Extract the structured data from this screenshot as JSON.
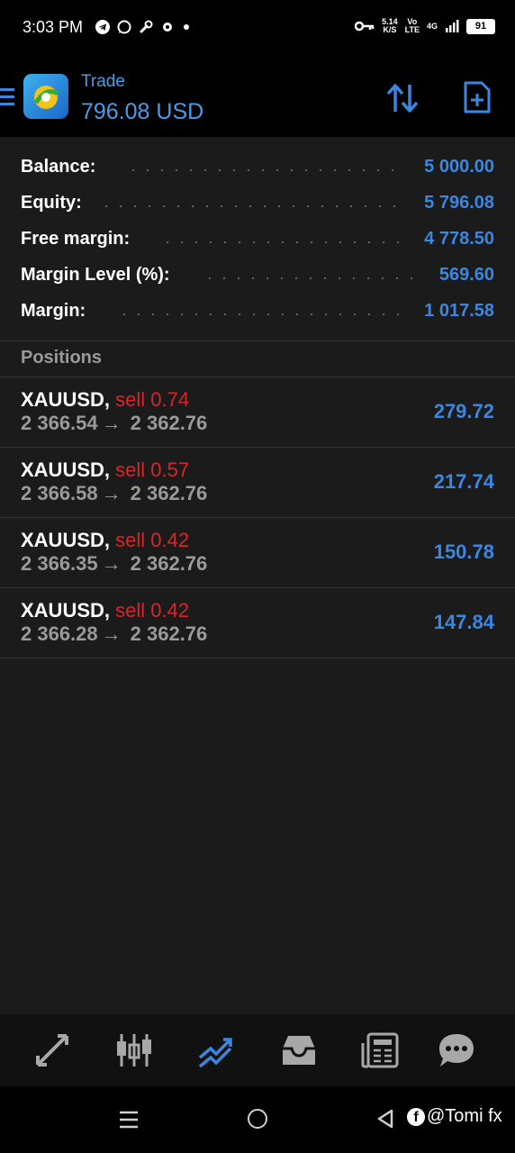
{
  "status_bar": {
    "time": "3:03 PM",
    "net_speed_value": "5.14",
    "net_speed_unit": "K/S",
    "volte_top": "Vo",
    "volte_bottom": "LTE",
    "network": "4G",
    "battery": "91"
  },
  "header": {
    "title": "Trade",
    "balance": "796.08 USD"
  },
  "summary": [
    {
      "label": "Balance:",
      "value": "5 000.00"
    },
    {
      "label": "Equity:",
      "value": "5 796.08"
    },
    {
      "label": "Free margin:",
      "value": "4 778.50"
    },
    {
      "label": "Margin Level (%):",
      "value": "569.60"
    },
    {
      "label": "Margin:",
      "value": "1 017.58"
    }
  ],
  "positions_header": "Positions",
  "positions": [
    {
      "symbol": "XAUUSD,",
      "type": "sell 0.74",
      "open": "2 366.54",
      "arrow": "→",
      "current": "2 362.76",
      "profit": "279.72"
    },
    {
      "symbol": "XAUUSD,",
      "type": "sell 0.57",
      "open": "2 366.58",
      "arrow": "→",
      "current": "2 362.76",
      "profit": "217.74"
    },
    {
      "symbol": "XAUUSD,",
      "type": "sell 0.42",
      "open": "2 366.35",
      "arrow": "→",
      "current": "2 362.76",
      "profit": "150.78"
    },
    {
      "symbol": "XAUUSD,",
      "type": "sell 0.42",
      "open": "2 366.28",
      "arrow": "→",
      "current": "2 362.76",
      "profit": "147.84"
    }
  ],
  "bottom_nav": [
    {
      "name": "quotes",
      "icon": "quotes-icon",
      "active": false
    },
    {
      "name": "chart",
      "icon": "candlestick-icon",
      "active": false
    },
    {
      "name": "trade",
      "icon": "trade-icon",
      "active": true
    },
    {
      "name": "history",
      "icon": "inbox-icon",
      "active": false
    },
    {
      "name": "news",
      "icon": "news-icon",
      "active": false
    },
    {
      "name": "messages",
      "icon": "chat-icon",
      "active": false
    }
  ],
  "watermark": "@Tomi fx",
  "colors": {
    "accent": "#3b87e0",
    "sell": "#d8262b",
    "background": "#1b1b1b"
  }
}
